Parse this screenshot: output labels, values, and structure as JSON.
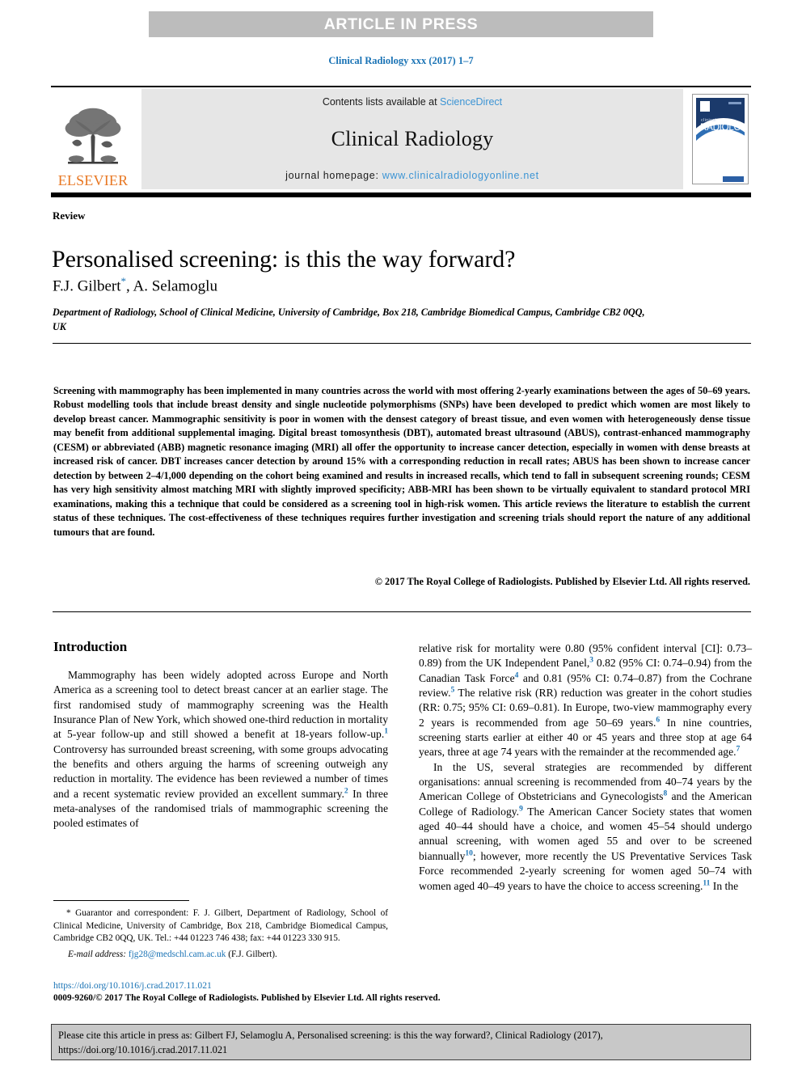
{
  "banner": {
    "label": "ARTICLE IN PRESS",
    "bg_color": "#bcbcbc",
    "text_color": "#ffffff"
  },
  "journal_ref": "Clinical Radiology xxx (2017) 1–7",
  "masthead": {
    "publisher_name": "ELSEVIER",
    "publisher_color": "#e87722",
    "contents_prefix": "Contents lists available at ",
    "contents_link": "ScienceDirect",
    "journal_title": "Clinical Radiology",
    "homepage_prefix": "journal homepage: ",
    "homepage_url": "www.clinicalradiologyonline.net",
    "link_color": "#3c94d4",
    "cover": {
      "line1": "clinical",
      "line2": "RADIOLOGY",
      "bg_color": "#1b3a6b"
    }
  },
  "article": {
    "kicker": "Review",
    "title": "Personalised screening: is this the way forward?",
    "authors": "F.J. Gilbert",
    "author_star": "*",
    "authors_rest": ", A. Selamoglu",
    "affiliation": "Department of Radiology, School of Clinical Medicine, University of Cambridge, Box 218, Cambridge Biomedical Campus, Cambridge CB2 0QQ, UK"
  },
  "abstract": {
    "text": "Screening with mammography has been implemented in many countries across the world with most offering 2-yearly examinations between the ages of 50–69 years. Robust modelling tools that include breast density and single nucleotide polymorphisms (SNPs) have been developed to predict which women are most likely to develop breast cancer. Mammographic sensitivity is poor in women with the densest category of breast tissue, and even women with heterogeneously dense tissue may benefit from additional supplemental imaging. Digital breast tomosynthesis (DBT), automated breast ultrasound (ABUS), contrast-enhanced mammography (CESM) or abbreviated (ABB) magnetic resonance imaging (MRI) all offer the opportunity to increase cancer detection, especially in women with dense breasts at increased risk of cancer. DBT increases cancer detection by around 15% with a corresponding reduction in recall rates; ABUS has been shown to increase cancer detection by between 2–4/1,000 depending on the cohort being examined and results in increased recalls, which tend to fall in subsequent screening rounds; CESM has very high sensitivity almost matching MRI with slightly improved specificity; ABB-MRI has been shown to be virtually equivalent to standard protocol MRI examinations, making this a technique that could be considered as a screening tool in high-risk women. This article reviews the literature to establish the current status of these techniques. The cost-effectiveness of these techniques requires further investigation and screening trials should report the nature of any additional tumours that are found.",
    "copyright": "© 2017 The Royal College of Radiologists. Published by Elsevier Ltd. All rights reserved."
  },
  "body": {
    "heading": "Introduction",
    "left_paragraph_1_a": "Mammography has been widely adopted across Europe and North America as a screening tool to detect breast cancer at an earlier stage. The first randomised study of mammography screening was the Health Insurance Plan of New York, which showed one-third reduction in mortality at 5-year follow-up and still showed a benefit at 18-years follow-up.",
    "ref1": "1",
    "left_paragraph_1_b": " Controversy has surrounded breast screening, with some groups advocating the benefits and others arguing the harms of screening outweigh any reduction in mortality. The evidence has been reviewed a number of times and a recent systematic review provided an excellent summary.",
    "ref2": "2",
    "left_paragraph_1_c": " In three meta-analyses of the randomised trials of mammographic screening the pooled estimates of",
    "right_paragraph_1_a": "relative risk for mortality were 0.80 (95% confident interval [CI]: 0.73–0.89) from the UK Independent Panel,",
    "ref3": "3",
    "right_paragraph_1_b": " 0.82 (95% CI: 0.74–0.94) from the Canadian Task Force",
    "ref4": "4",
    "right_paragraph_1_c": " and 0.81 (95% CI: 0.74–0.87) from the Cochrane review.",
    "ref5": "5",
    "right_paragraph_1_d": " The relative risk (RR) reduction was greater in the cohort studies (RR: 0.75; 95% CI: 0.69–0.81). In Europe, two-view mammography every 2 years is recommended from age 50–69 years.",
    "ref6": "6",
    "right_paragraph_1_e": " In nine countries, screening starts earlier at either 40 or 45 years and three stop at age 64 years, three at age 74 years with the remainder at the recommended age.",
    "ref7": "7",
    "right_paragraph_2_a": "In the US, several strategies are recommended by different organisations: annual screening is recommended from 40–74 years by the American College of Obstetricians and Gynecologists",
    "ref8": "8",
    "right_paragraph_2_b": " and the American College of Radiology.",
    "ref9": "9",
    "right_paragraph_2_c": " The American Cancer Society states that women aged 40–44 should have a choice, and women 45–54 should undergo annual screening, with women aged 55 and over to be screened biannually",
    "ref10": "10",
    "right_paragraph_2_d": "; however, more recently the US Preventative Services Task Force recommended 2-yearly screening for women aged 50–74 with women aged 40–49 years to have the choice to access screening.",
    "ref11": "11",
    "right_paragraph_2_e": " In the"
  },
  "footnote": {
    "star": "*",
    "correspondence": " Guarantor and correspondent: F. J. Gilbert, Department of Radiology, School of Clinical Medicine, University of Cambridge, Box 218, Cambridge Biomedical Campus, Cambridge CB2 0QQ, UK. Tel.: +44 01223 746 438; fax: +44 01223 330 915.",
    "email_label": "E-mail address:",
    "email": "fjg28@medschl.cam.ac.uk",
    "email_suffix": " (F.J. Gilbert).",
    "doi": "https://doi.org/10.1016/j.crad.2017.11.021",
    "issn_line": "0009-9260/© 2017 The Royal College of Radiologists. Published by Elsevier Ltd. All rights reserved."
  },
  "citation_box": {
    "text": "Please cite this article in press as: Gilbert FJ, Selamoglu A, Personalised screening: is this the way forward?, Clinical Radiology (2017), https://doi.org/10.1016/j.crad.2017.11.021",
    "bg_color": "#c8c8c8"
  }
}
